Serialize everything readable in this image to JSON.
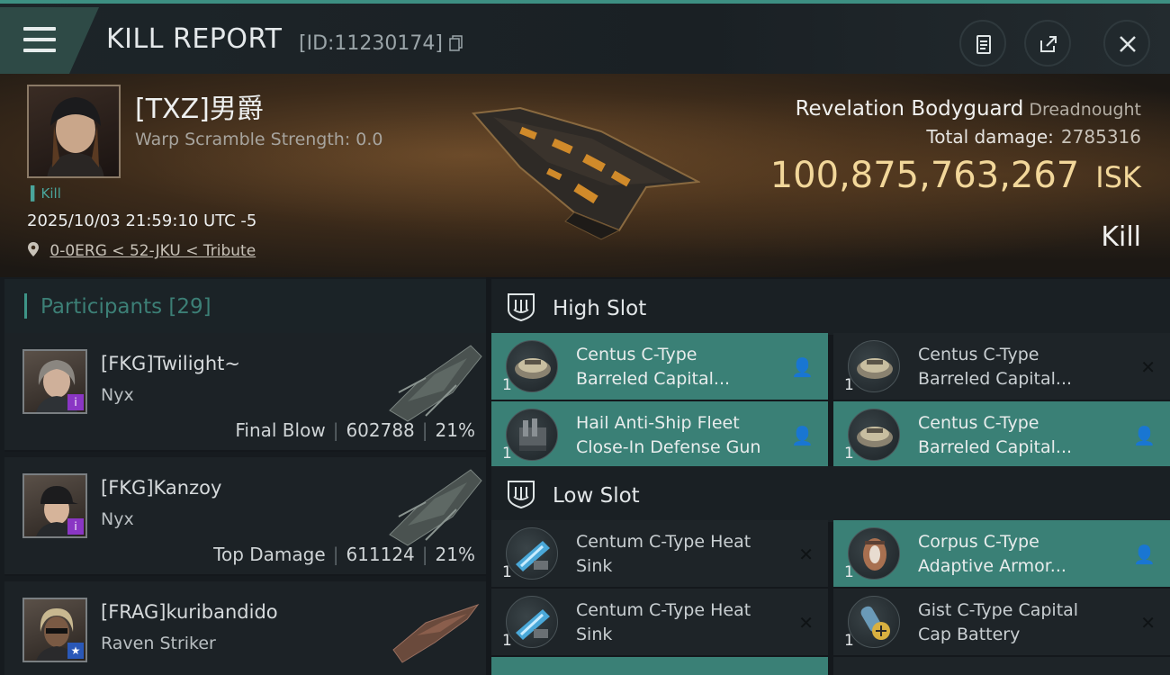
{
  "header": {
    "title": "KILL REPORT",
    "report_id": "[ID:11230174]",
    "menu_icon": "hamburger-icon",
    "buttons": [
      "clipboard-icon",
      "share-icon",
      "close-icon"
    ]
  },
  "victim": {
    "name": "[TXZ]男爵",
    "warp_scramble": "Warp Scramble Strength: 0.0",
    "tag": "Kill",
    "time": "2025/10/03 21:59:10 UTC -5",
    "location": "0-0ERG < 52-JKU < Tribute",
    "ship_name": "Revelation Bodyguard",
    "ship_class": "Dreadnought",
    "total_damage_label": "Total damage:",
    "total_damage": "2785316",
    "isk_value": "100,875,763,267",
    "isk_unit": "ISK",
    "result": "Kill"
  },
  "participants": {
    "title": "Participants",
    "count": "[29]",
    "items": [
      {
        "name": "[FKG]Twilight~",
        "ship": "Nyx",
        "role": "Final Blow",
        "damage": "602788",
        "percent": "21%",
        "badge": "i"
      },
      {
        "name": "[FKG]Kanzoy",
        "ship": "Nyx",
        "role": "Top Damage",
        "damage": "611124",
        "percent": "21%",
        "badge": "i"
      },
      {
        "name": "[FRAG]kuribandido",
        "ship": "Raven Striker",
        "role": "",
        "damage": "",
        "percent": "",
        "badge": "★"
      }
    ]
  },
  "slots": {
    "high": {
      "label": "High Slot",
      "modules": [
        {
          "line1": "Centus C-Type",
          "line2": "Barreled Capital...",
          "qty": "1"
        },
        {
          "line1": "Centus C-Type",
          "line2": "Barreled Capital...",
          "qty": "1"
        },
        {
          "line1": "Hail Anti-Ship Fleet",
          "line2": "Close-In Defense Gun",
          "qty": "1"
        },
        {
          "line1": "Centus C-Type",
          "line2": "Barreled Capital...",
          "qty": "1"
        }
      ]
    },
    "low": {
      "label": "Low Slot",
      "modules": [
        {
          "line1": "Centum C-Type Heat",
          "line2": "Sink",
          "qty": "1"
        },
        {
          "line1": "Corpus C-Type",
          "line2": "Adaptive Armor...",
          "qty": "1"
        },
        {
          "line1": "Centum C-Type Heat",
          "line2": "Sink",
          "qty": "1"
        },
        {
          "line1": "Gist C-Type Capital",
          "line2": "Cap Battery",
          "qty": "1"
        }
      ]
    }
  },
  "flags": {
    "dropped": "person-icon",
    "destroyed": "x-icon"
  },
  "colors": {
    "accent": "#3e9487",
    "isk": "#f2d79a",
    "active_module": "#3a8076"
  }
}
